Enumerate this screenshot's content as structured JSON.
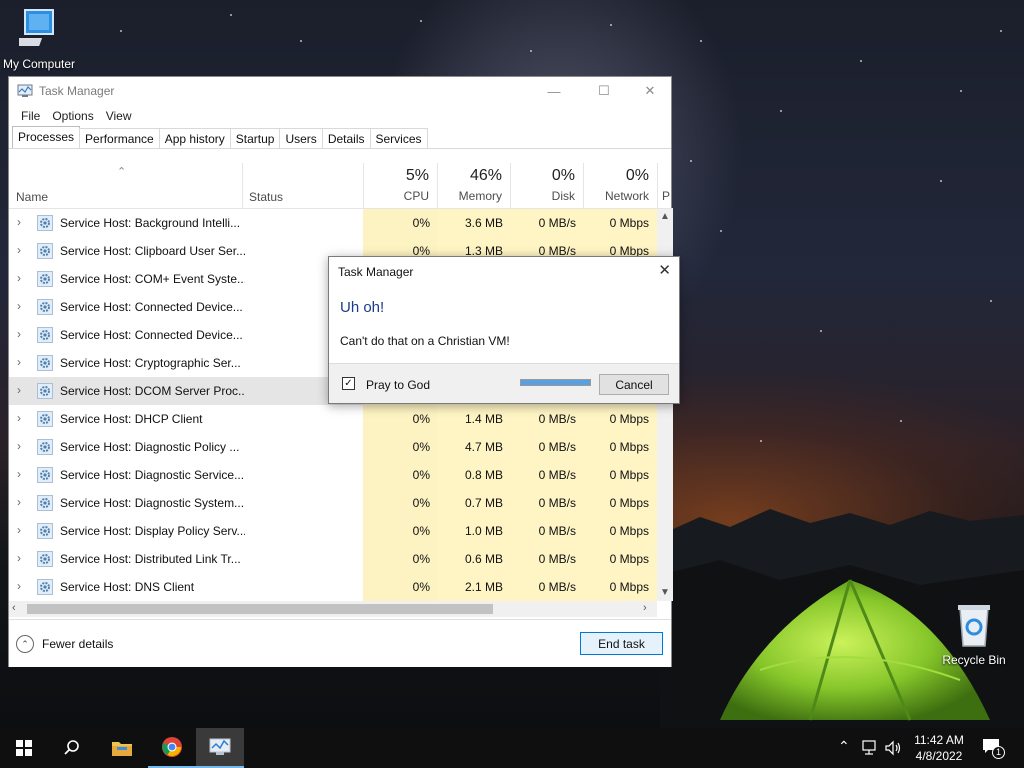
{
  "desktop": {
    "icons": [
      {
        "label": "My Computer"
      },
      {
        "label": "Recycle Bin"
      }
    ]
  },
  "task_manager": {
    "title": "Task Manager",
    "menu": [
      "File",
      "Options",
      "View"
    ],
    "tabs": [
      "Processes",
      "Performance",
      "App history",
      "Startup",
      "Users",
      "Details",
      "Services"
    ],
    "active_tab": "Processes",
    "columns": {
      "name": "Name",
      "status": "Status",
      "cpu": {
        "pct": "5%",
        "label": "CPU"
      },
      "memory": {
        "pct": "46%",
        "label": "Memory"
      },
      "disk": {
        "pct": "0%",
        "label": "Disk"
      },
      "network": {
        "pct": "0%",
        "label": "Network"
      },
      "power": "P"
    },
    "processes": [
      {
        "name": "Service Host: Background Intelli...",
        "cpu": "0%",
        "memory": "3.6 MB",
        "disk": "0 MB/s",
        "network": "0 Mbps"
      },
      {
        "name": "Service Host: Clipboard User Ser...",
        "cpu": "0%",
        "memory": "1.3 MB",
        "disk": "0 MB/s",
        "network": "0 Mbps"
      },
      {
        "name": "Service Host: COM+ Event Syste...",
        "cpu": "",
        "memory": "",
        "disk": "",
        "network": ""
      },
      {
        "name": "Service Host: Connected Device...",
        "cpu": "",
        "memory": "",
        "disk": "",
        "network": ""
      },
      {
        "name": "Service Host: Connected Device...",
        "cpu": "",
        "memory": "",
        "disk": "",
        "network": ""
      },
      {
        "name": "Service Host: Cryptographic Ser...",
        "cpu": "",
        "memory": "",
        "disk": "",
        "network": ""
      },
      {
        "name": "Service Host: DCOM Server Proc...",
        "cpu": "",
        "memory": "",
        "disk": "",
        "network": ""
      },
      {
        "name": "Service Host: DHCP Client",
        "cpu": "0%",
        "memory": "1.4 MB",
        "disk": "0 MB/s",
        "network": "0 Mbps"
      },
      {
        "name": "Service Host: Diagnostic Policy ...",
        "cpu": "0%",
        "memory": "4.7 MB",
        "disk": "0 MB/s",
        "network": "0 Mbps"
      },
      {
        "name": "Service Host: Diagnostic Service...",
        "cpu": "0%",
        "memory": "0.8 MB",
        "disk": "0 MB/s",
        "network": "0 Mbps"
      },
      {
        "name": "Service Host: Diagnostic System...",
        "cpu": "0%",
        "memory": "0.7 MB",
        "disk": "0 MB/s",
        "network": "0 Mbps"
      },
      {
        "name": "Service Host: Display Policy Serv...",
        "cpu": "0%",
        "memory": "1.0 MB",
        "disk": "0 MB/s",
        "network": "0 Mbps"
      },
      {
        "name": "Service Host: Distributed Link Tr...",
        "cpu": "0%",
        "memory": "0.6 MB",
        "disk": "0 MB/s",
        "network": "0 Mbps"
      },
      {
        "name": "Service Host: DNS Client",
        "cpu": "0%",
        "memory": "2.1 MB",
        "disk": "0 MB/s",
        "network": "0 Mbps"
      }
    ],
    "selected_row": 6,
    "footer": {
      "fewer_details": "Fewer details",
      "end_task": "End task"
    }
  },
  "dialog": {
    "title": "Task Manager",
    "heading": "Uh oh!",
    "message": "Can't do that on a Christian VM!",
    "checkbox_label": "Pray to God",
    "checkbox_checked": true,
    "progress": 1.0,
    "cancel_label": "Cancel"
  },
  "taskbar": {
    "apps": [
      "start-icon",
      "search-icon",
      "file-explorer-icon",
      "chrome-icon",
      "task-manager-icon"
    ],
    "time": "11:42 AM",
    "date": "4/8/2022",
    "notification_count": "1"
  },
  "colors": {
    "accent": "#0078d7",
    "heading_blue": "#1c3b8f",
    "heat": "#fcf2c2"
  }
}
